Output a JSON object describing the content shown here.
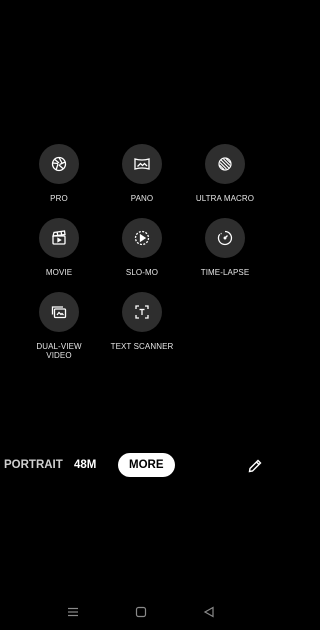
{
  "modes": [
    {
      "label": "PRO",
      "icon": "aperture-icon"
    },
    {
      "label": "PANO",
      "icon": "panorama-icon"
    },
    {
      "label": "ULTRA MACRO",
      "icon": "macro-icon"
    },
    {
      "label": "MOVIE",
      "icon": "clapperboard-icon"
    },
    {
      "label": "SLO-MO",
      "icon": "slow-motion-icon"
    },
    {
      "label": "TIME-LAPSE",
      "icon": "timelapse-icon"
    },
    {
      "label_line1": "DUAL-VIEW",
      "label_line2": "VIDEO",
      "icon": "dual-view-icon"
    },
    {
      "label": "TEXT SCANNER",
      "icon": "text-scanner-icon"
    }
  ],
  "mode_bar": {
    "portrait": "PORTRAIT",
    "m48": "48M",
    "more": "MORE"
  },
  "colors": {
    "background": "#000000",
    "circle": "#2e2e2e",
    "active_pill": "#ffffff"
  },
  "nav": {
    "icons": [
      "menu-icon",
      "home-square-icon",
      "back-triangle-icon"
    ]
  }
}
